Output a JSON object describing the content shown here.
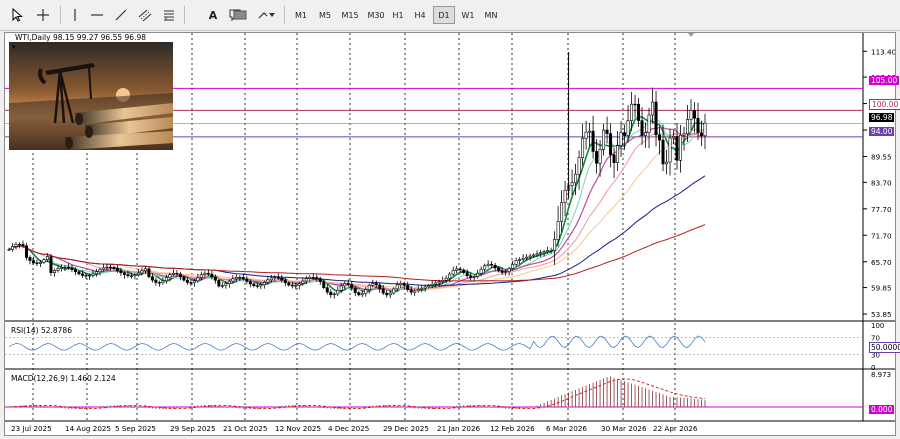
{
  "toolbar": {
    "tools": [
      {
        "name": "cursor-tool",
        "icon": "arrow-cursor-icon"
      },
      {
        "name": "crosshair-tool",
        "icon": "crosshair-icon"
      },
      {
        "name": "vertical-line-tool",
        "icon": "vertical-line-icon"
      },
      {
        "name": "horizontal-line-tool",
        "icon": "horizontal-line-icon"
      },
      {
        "name": "trendline-tool",
        "icon": "trendline-icon"
      },
      {
        "name": "channel-tool",
        "icon": "equidistant-channel-icon"
      },
      {
        "name": "fibonacci-tool",
        "icon": "fibonacci-icon"
      },
      {
        "name": "text-tool",
        "icon": "text-icon",
        "label": "A"
      },
      {
        "name": "text-label-tool",
        "icon": "text-label-icon"
      },
      {
        "name": "shapes-tool",
        "icon": "rectangle-icon"
      },
      {
        "name": "arrows-tool",
        "icon": "arrows-dropdown-icon"
      }
    ],
    "timeframes": [
      "M1",
      "M5",
      "M15",
      "M30",
      "H1",
      "H4",
      "D1",
      "W1",
      "MN"
    ],
    "active_timeframe": "D1"
  },
  "chart": {
    "title": "WTI,Daily  98.15 99.27 96.55 96.98",
    "image_caption": "oil-pumpjack-and-pipelines-photo",
    "price_axis": [
      "113.40",
      "107.55",
      "101.55",
      "95.55",
      "89.55",
      "83.70",
      "77.70",
      "71.70",
      "65.70",
      "59.85",
      "53.85"
    ],
    "levels": [
      {
        "value": 105.0,
        "label": "105.00",
        "color": "#d400d4"
      },
      {
        "value": 100.0,
        "label": "100.00",
        "color": "#b03050"
      },
      {
        "value": 94.0,
        "label": "94.00",
        "color": "#6a3fb0"
      }
    ],
    "current_price": "96.98",
    "date_axis": [
      "23 Jul 2025",
      "14 Aug 2025",
      "5 Sep 2025",
      "29 Sep 2025",
      "21 Oct 2025",
      "12 Nov 2025",
      "4 Dec 2025",
      "29 Dec 2025",
      "21 Jan 2026",
      "12 Feb 2026",
      "6 Mar 2026",
      "30 Mar 2026",
      "22 Apr 2026"
    ]
  },
  "rsi": {
    "title": "RSI(14) 52.8786",
    "axis": [
      "100",
      "70",
      "30",
      "0"
    ],
    "level_label": "50.0000"
  },
  "macd": {
    "title": "MACD(12,26,9) 1.460 2.124",
    "axis_top": "8.973",
    "zero_label": "0.000"
  },
  "colors": {
    "candle": "#000000",
    "ma_fast": "#0f8a3c",
    "ma_2": "#7fd0c8",
    "ma_3": "#c04aa0",
    "ma_4": "#f0a0a0",
    "ma_5": "#f5c690",
    "ma_6": "#1c1c80",
    "ma_7": "#b02020",
    "rsi_line": "#4a7fc0",
    "macd_hist": "#8a3030",
    "macd_signal": "#d02020"
  }
}
